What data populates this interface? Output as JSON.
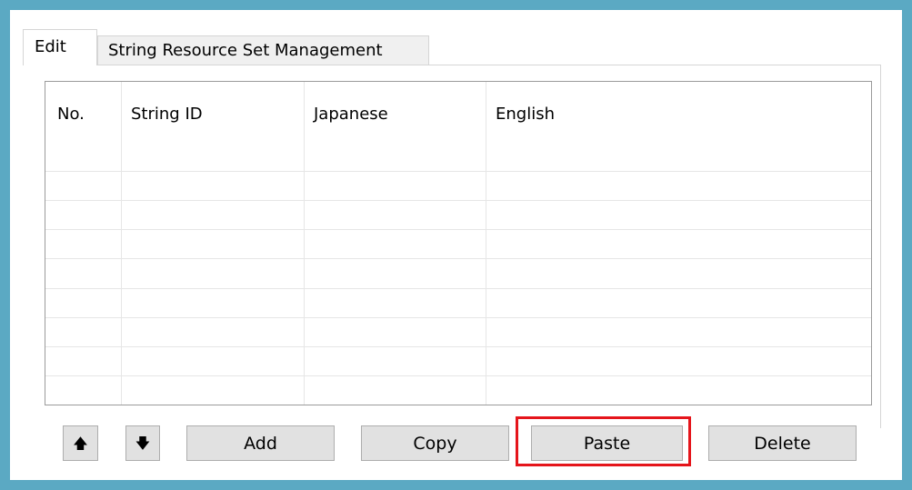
{
  "tabs": [
    {
      "label": "Edit",
      "active": true
    },
    {
      "label": "String Resource Set Management",
      "active": false
    }
  ],
  "grid": {
    "columns": [
      "No.",
      "String ID",
      "Japanese",
      "English"
    ],
    "rows": []
  },
  "buttons": {
    "move_up_icon": "arrow-up-icon",
    "move_down_icon": "arrow-down-icon",
    "move_up_glyph": "🡅",
    "move_down_glyph": "🡇",
    "add": "Add",
    "copy": "Copy",
    "paste": "Paste",
    "delete": "Delete"
  },
  "colors": {
    "frame": "#5ba9c3",
    "highlight": "#e5151b"
  }
}
